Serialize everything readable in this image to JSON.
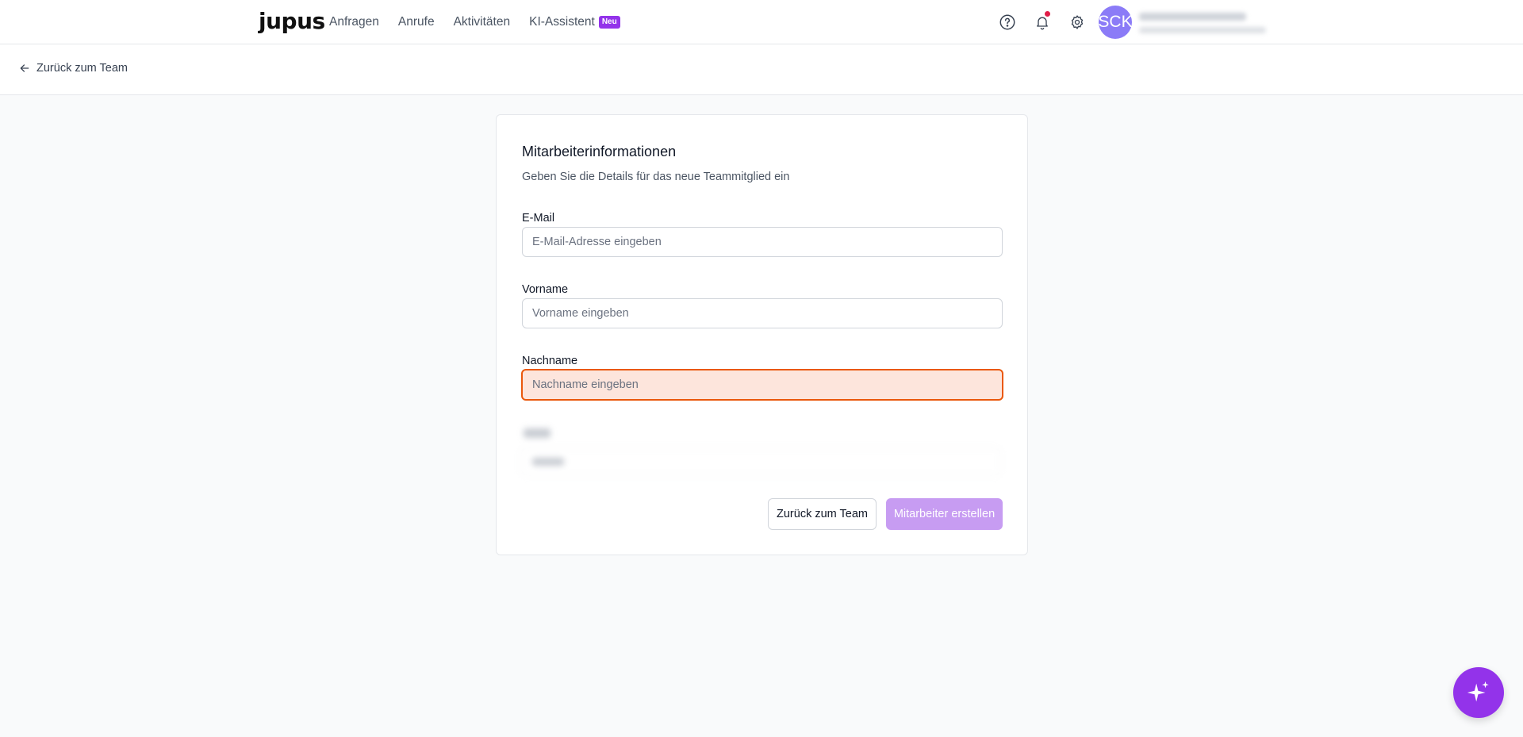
{
  "header": {
    "logo": "jupus",
    "nav": [
      {
        "label": "Anfragen"
      },
      {
        "label": "Anrufe"
      },
      {
        "label": "Aktivitäten"
      },
      {
        "label": "KI-Assistent",
        "badge": "Neu"
      }
    ],
    "avatar_initials": "SCK",
    "icons": [
      "help-circle-icon",
      "bell-icon",
      "gear-icon"
    ]
  },
  "subheader": {
    "back_label": "Zurück zum Team"
  },
  "form": {
    "title": "Mitarbeiterinformationen",
    "subtitle": "Geben Sie die Details für das neue Teammitglied ein",
    "email_label": "E-Mail",
    "email_placeholder": "E-Mail-Adresse eingeben",
    "first_name_label": "Vorname",
    "first_name_placeholder": "Vorname eingeben",
    "last_name_label": "Nachname",
    "last_name_placeholder": "Nachname eingeben",
    "cancel_label": "Zurück zum Team",
    "submit_label": "Mitarbeiter erstellen"
  },
  "colors": {
    "accent": "#9333ea",
    "error_border": "#ea580c",
    "error_bg": "#fde5dc",
    "avatar_bg": "#8b7bf7",
    "notification_dot": "#e11d48"
  }
}
